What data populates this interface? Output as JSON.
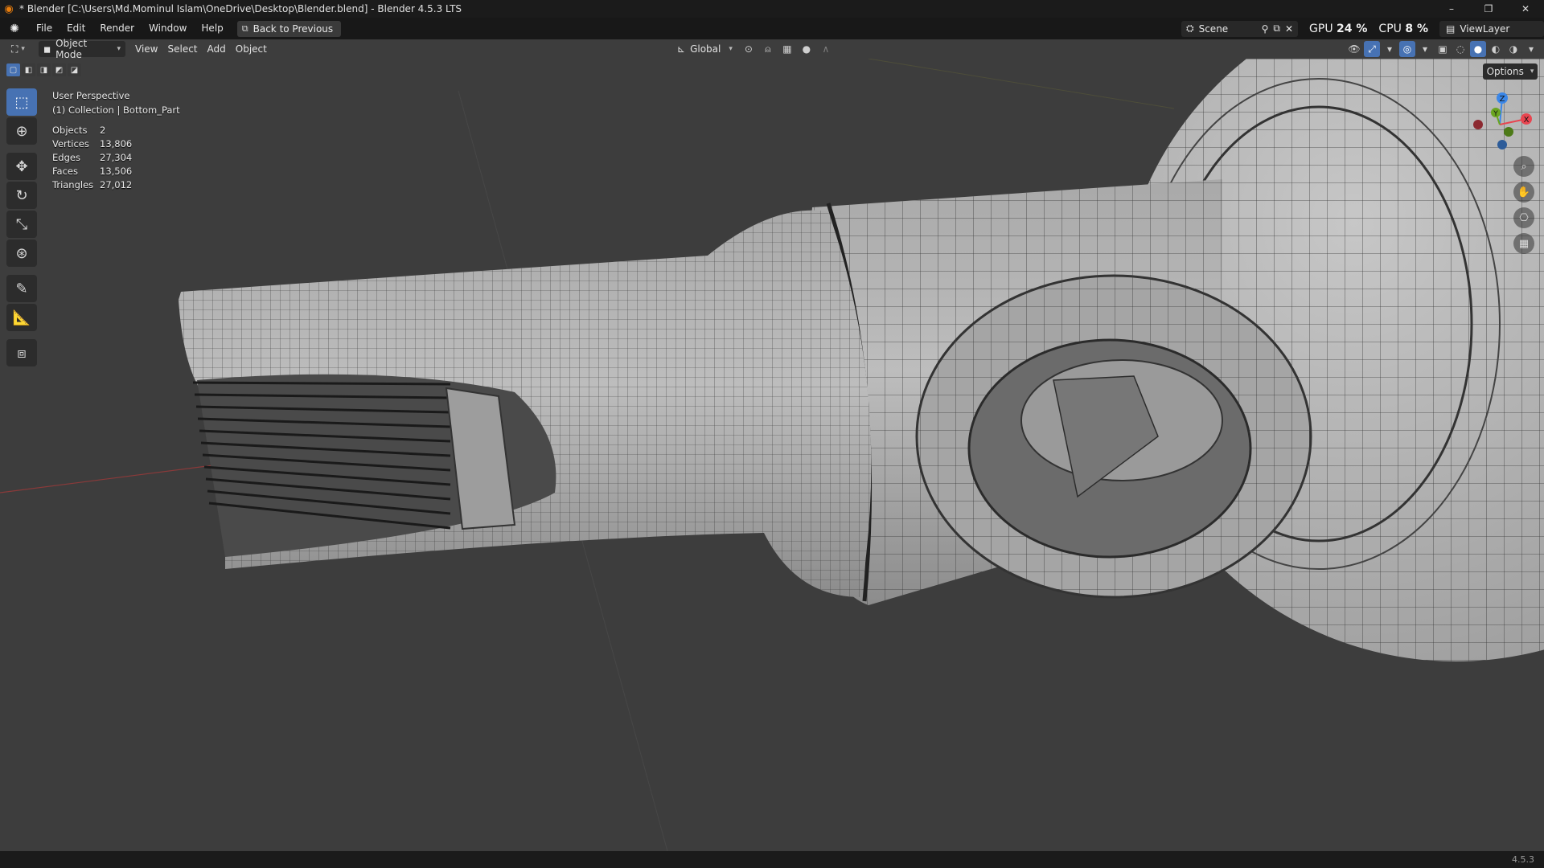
{
  "window": {
    "title": "* Blender [C:\\Users\\Md.Mominul Islam\\OneDrive\\Desktop\\Blender.blend] - Blender 4.5.3 LTS",
    "controls": [
      "–",
      "❐",
      "✕"
    ]
  },
  "menu": {
    "items": [
      "File",
      "Edit",
      "Render",
      "Window",
      "Help"
    ],
    "back_button": "Back to Previous"
  },
  "topright": {
    "scene": "Scene",
    "gpu_label": "GPU",
    "gpu_value": "24 %",
    "cpu_label": "CPU",
    "cpu_value": "8 %",
    "view_layer": "ViewLayer"
  },
  "viewport_header": {
    "mode": "Object Mode",
    "menus": [
      "View",
      "Select",
      "Add",
      "Object"
    ],
    "orientation": "Global",
    "options": "Options"
  },
  "overlay": {
    "perspective": "User Perspective",
    "collection": "(1) Collection | Bottom_Part"
  },
  "stats": [
    {
      "label": "Objects",
      "value": "2"
    },
    {
      "label": "Vertices",
      "value": "13,806"
    },
    {
      "label": "Edges",
      "value": "27,304"
    },
    {
      "label": "Faces",
      "value": "13,506"
    },
    {
      "label": "Triangles",
      "value": "27,012"
    }
  ],
  "gizmo": {
    "x": "X",
    "y": "Y",
    "z": "Z"
  },
  "status": {
    "version": "4.5.3"
  },
  "colors": {
    "accent": "#4772b3",
    "viewport": "#3d3d3d",
    "axis_x": "#e84550",
    "axis_y": "#6aa51f",
    "axis_z": "#3b87e8"
  }
}
